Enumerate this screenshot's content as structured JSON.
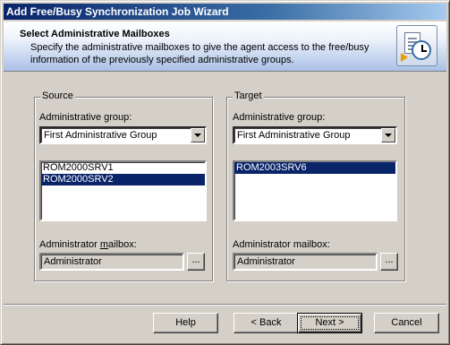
{
  "window": {
    "title": "Add Free/Busy Synchronization Job Wizard"
  },
  "header": {
    "title": "Select Administrative Mailboxes",
    "description": "Specify the administrative mailboxes to give the agent access to the free/busy information of the previously specified administrative groups.",
    "icon": "wizard-calendar-clock-icon"
  },
  "source": {
    "legend": "Source",
    "group_label": "Administrative group:",
    "group_value": "First Administrative Group",
    "servers": [
      {
        "name": "ROM2000SRV1",
        "selected": false
      },
      {
        "name": "ROM2000SRV2",
        "selected": true
      }
    ],
    "mailbox_label": "Administrator mailbox:",
    "mailbox_value": "Administrator",
    "browse_label": "..."
  },
  "target": {
    "legend": "Target",
    "group_label": "Administrative group:",
    "group_value": "First Administrative Group",
    "servers": [
      {
        "name": "ROM2003SRV6",
        "selected": true
      }
    ],
    "mailbox_label": "Administrator mailbox:",
    "mailbox_value": "Administrator",
    "browse_label": "..."
  },
  "buttons": {
    "help": "Help",
    "back": "< Back",
    "next": "Next >",
    "cancel": "Cancel"
  },
  "colors": {
    "titlebar": "#0a246a",
    "selection": "#0a246a",
    "face": "#d4d0c8"
  }
}
